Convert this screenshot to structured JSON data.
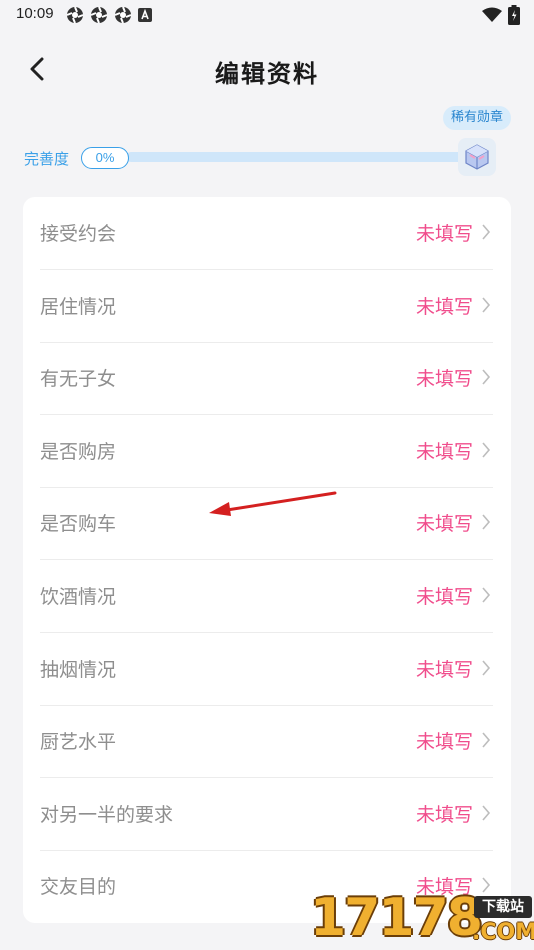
{
  "status_bar": {
    "time": "10:09",
    "icons": [
      "aperture-icon",
      "aperture-icon",
      "aperture-icon",
      "a-box-icon"
    ],
    "right_icons": [
      "wifi-icon",
      "battery-icon"
    ]
  },
  "nav": {
    "title": "编辑资料"
  },
  "progress": {
    "label": "完善度",
    "percent_text": "0%",
    "percent": 0,
    "badge_tag": "稀有勋章"
  },
  "list": {
    "items": [
      {
        "label": "接受约会",
        "value": "未填写"
      },
      {
        "label": "居住情况",
        "value": "未填写"
      },
      {
        "label": "有无子女",
        "value": "未填写"
      },
      {
        "label": "是否购房",
        "value": "未填写"
      },
      {
        "label": "是否购车",
        "value": "未填写"
      },
      {
        "label": "饮酒情况",
        "value": "未填写"
      },
      {
        "label": "抽烟情况",
        "value": "未填写"
      },
      {
        "label": "厨艺水平",
        "value": "未填写"
      },
      {
        "label": "对另一半的要求",
        "value": "未填写"
      },
      {
        "label": "交友目的",
        "value": "未填写"
      }
    ]
  },
  "watermark": {
    "digits": "17178",
    "tag": "下载站",
    "domain": ".COM"
  },
  "colors": {
    "accent_blue": "#3aa0e8",
    "value_pink": "#f04d8c",
    "label_gray": "#8e8e8e",
    "annotation_red": "#d42020"
  }
}
